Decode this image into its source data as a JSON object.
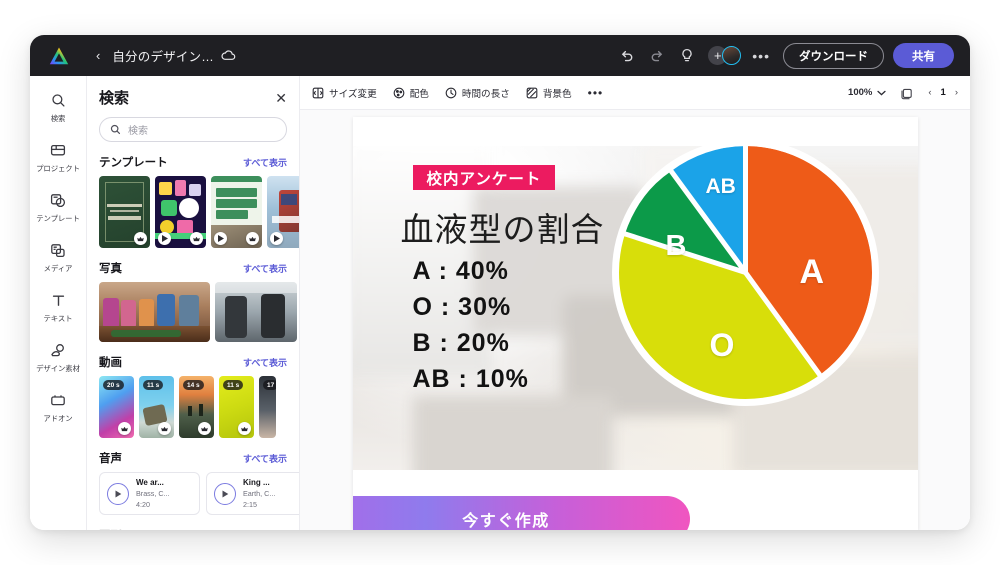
{
  "topbar": {
    "logo": "canva-logo-icon",
    "back": "‹",
    "doc_title": "自分のデザイン…",
    "cloud_icon": "cloud-icon",
    "undo": "undo-icon",
    "redo": "redo-icon",
    "idea": "lightbulb-icon",
    "plus": "+",
    "avatar": "user-avatar",
    "more": "•••",
    "download_label": "ダウンロード",
    "share_label": "共有",
    "share_color": "#5b5bd6"
  },
  "rail": {
    "items": [
      {
        "icon": "search-icon",
        "label": "検索"
      },
      {
        "icon": "folder-icon",
        "label": "プロジェクト"
      },
      {
        "icon": "templates-icon",
        "label": "テンプレート"
      },
      {
        "icon": "media-icon",
        "label": "メディア"
      },
      {
        "icon": "text-icon",
        "label": "テキスト"
      },
      {
        "icon": "elements-icon",
        "label": "デザイン素材"
      },
      {
        "icon": "apps-icon",
        "label": "アドオン"
      }
    ]
  },
  "panel": {
    "title": "検索",
    "close": "✕",
    "search_placeholder": "検索",
    "see_all": "すべて表示",
    "sections": [
      {
        "title": "テンプレート"
      },
      {
        "title": "写真"
      },
      {
        "title": "動画"
      },
      {
        "title": "音声"
      }
    ],
    "videos": [
      {
        "duration": "20 s"
      },
      {
        "duration": "11 s"
      },
      {
        "duration": "14 s"
      },
      {
        "duration": "11 s"
      },
      {
        "duration": "17"
      }
    ],
    "audio": [
      {
        "title": "We ar...",
        "artist": "Brass, C...",
        "duration": "4:20"
      },
      {
        "title": "King ...",
        "artist": "Earth, C...",
        "duration": "2:15"
      }
    ]
  },
  "editor_toolbar": {
    "items": [
      {
        "icon": "resize-icon",
        "label": "サイズ変更"
      },
      {
        "icon": "palette-icon",
        "label": "配色"
      },
      {
        "icon": "clock-icon",
        "label": "時間の長さ"
      },
      {
        "icon": "texture-icon",
        "label": "背景色"
      }
    ],
    "more": "•••",
    "zoom_level": "100%",
    "zoom_caret": "chevron-down-icon",
    "pages_icon": "pages-icon",
    "prev": "‹",
    "page_number": "1",
    "next": "›"
  },
  "canvas": {
    "ribbon_label": "校内アンケート",
    "ribbon_color": "#ec1b60",
    "title": "血液型の割合",
    "stats": [
      "A : 40%",
      "O : 30%",
      "B : 20%",
      "AB : 10%"
    ],
    "cta_label": "今すぐ作成"
  },
  "chart_data": {
    "type": "pie",
    "title": "血液型の割合",
    "subtitle": "校内アンケート",
    "labels": [
      "A",
      "O",
      "B",
      "AB"
    ],
    "values": [
      40,
      30,
      20,
      10
    ],
    "unit": "%",
    "colors": [
      "#ee5b18",
      "#d8de0a",
      "#0c9a49",
      "#1ba3e8"
    ],
    "start_angle_deg": 0,
    "direction": "clockwise",
    "legend": "none",
    "slice_labels_inside": true
  }
}
